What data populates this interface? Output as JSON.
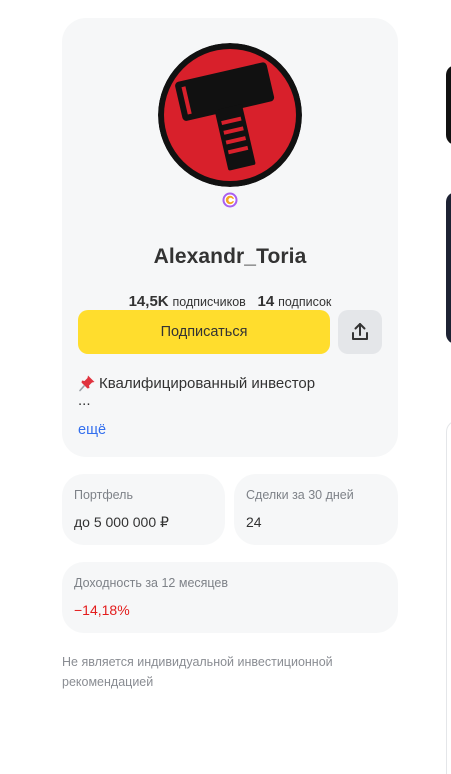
{
  "profile": {
    "username": "Alexandr_Toria",
    "followers_count": "14,5K",
    "followers_label": "подписчиков",
    "following_count": "14",
    "following_label": "подписок",
    "subscribe_label": "Подписаться",
    "bio_line": "Квалифицированный инвестор",
    "bio_more": "...",
    "more_link": "ещё",
    "badge_icon": "premium-c-badge-icon",
    "avatar_colors": {
      "ring": "#111111",
      "background": "#d8202b",
      "hammer": "#111111"
    }
  },
  "stats_cards": {
    "portfolio": {
      "label": "Портфель",
      "value": "до 5 000 000 ₽"
    },
    "trades": {
      "label": "Сделки за 30 дней",
      "value": "24"
    },
    "yield": {
      "label": "Доходность за 12 месяцев",
      "value": "−14,18%"
    }
  },
  "disclaimer": "Не является индивидуальной инвестиционной рекомендацией",
  "colors": {
    "accent_button": "#ffdd2d",
    "card_bg": "#f6f7f8",
    "link": "#336fee",
    "negative": "#e31c1c"
  }
}
